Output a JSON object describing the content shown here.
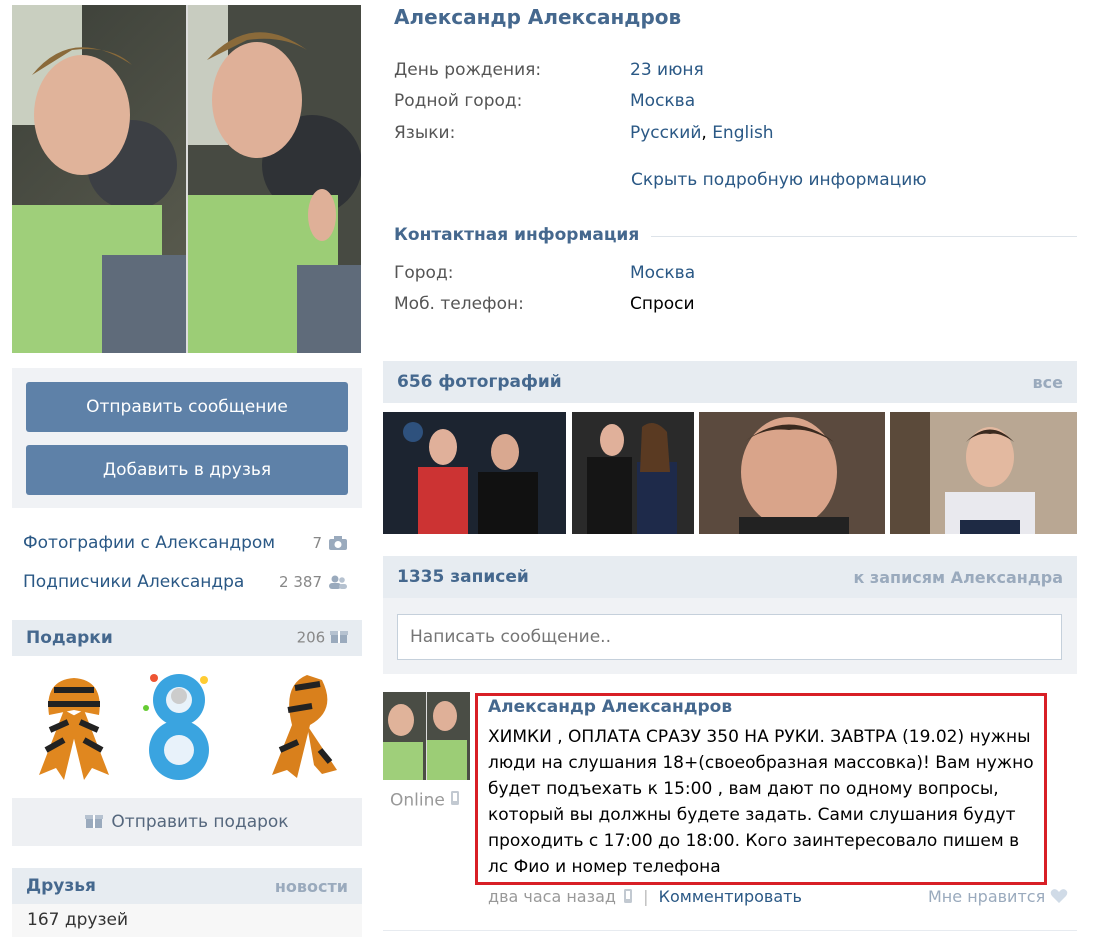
{
  "profile": {
    "name": "Александр Александров",
    "info_rows": [
      {
        "label": "День рождения:",
        "value": "23 июня"
      },
      {
        "label": "Родной город:",
        "value": "Москва"
      },
      {
        "label": "Языки:",
        "value_parts": [
          "Русский",
          ", ",
          "English"
        ]
      }
    ],
    "hide_info_link": "Скрыть подробную информацию",
    "contact_title": "Контактная информация",
    "contact_rows": [
      {
        "label": "Город:",
        "value": "Москва"
      },
      {
        "label": "Моб. телефон:",
        "value": "Спроси"
      }
    ]
  },
  "actions": {
    "send_message": "Отправить сообщение",
    "add_friend": "Добавить в друзья"
  },
  "side_links": [
    {
      "label": "Фотографии с Александром",
      "count": "7",
      "icon": "camera-icon"
    },
    {
      "label": "Подписчики Александра",
      "count": "2 387",
      "icon": "followers-icon"
    }
  ],
  "gifts": {
    "title": "Подарки",
    "count": "206",
    "send_gift": "Отправить подарок"
  },
  "friends": {
    "title": "Друзья",
    "news_link": "новости",
    "count_text": "167 друзей"
  },
  "photos": {
    "title": "656 фотографий",
    "all_link": "все"
  },
  "wall": {
    "title": "1335 записей",
    "to_posts_link": "к записям Александра",
    "placeholder": "Написать сообщение.."
  },
  "post": {
    "author": "Александр Александров",
    "status": "Online",
    "text": "ХИМКИ , ОПЛАТА СРАЗУ 350 НА РУКИ. ЗАВТРА (19.02) нужны люди на слушания 18+(своеобразная массовка)! Вам нужно будет подъехать к 15:00 , вам дают по одному вопросы, который вы должны будете задать. Сами слушания будут проходить с 17:00 до 18:00. Кого заинтересовало пишем в лс Фио и номер телефона",
    "time": "два часа назад",
    "separator": "|",
    "comment_link": "Комментировать",
    "like_label": "Мне нравится"
  },
  "colors": {
    "link": "#2a5885",
    "button": "#5e81a8",
    "section_bg": "#e7ecf1",
    "highlight_border": "#d81f26"
  }
}
